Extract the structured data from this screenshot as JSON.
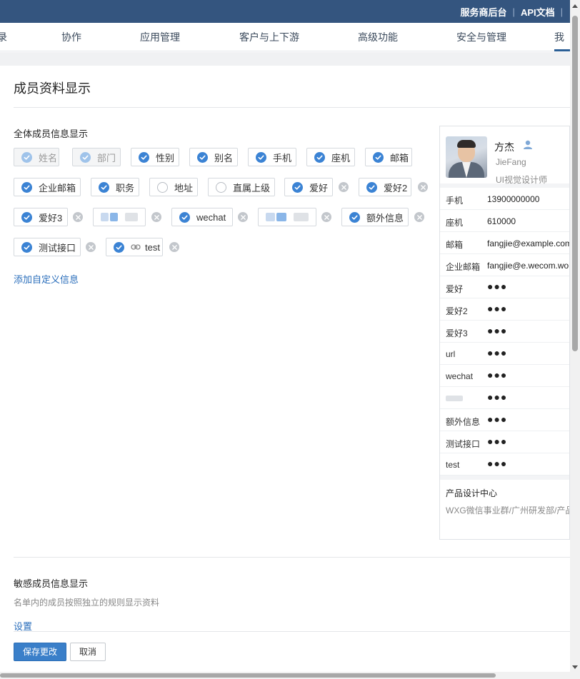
{
  "topbar": {
    "links": [
      "服务商后台",
      "API文档"
    ]
  },
  "nav": {
    "items": [
      "录",
      "协作",
      "应用管理",
      "客户与上下游",
      "高级功能",
      "安全与管理",
      "我"
    ]
  },
  "page_title": "成员资料显示",
  "all_section": {
    "label": "全体成员信息显示",
    "add_custom": "添加自定义信息"
  },
  "fields": [
    {
      "label": "姓名",
      "state": "locked"
    },
    {
      "label": "部门",
      "state": "locked"
    },
    {
      "label": "性别",
      "state": "checked"
    },
    {
      "label": "别名",
      "state": "checked"
    },
    {
      "label": "手机",
      "state": "checked"
    },
    {
      "label": "座机",
      "state": "checked"
    },
    {
      "label": "邮箱",
      "state": "checked"
    },
    {
      "label": "企业邮箱",
      "state": "checked"
    },
    {
      "label": "职务",
      "state": "checked"
    },
    {
      "label": "地址",
      "state": "unchecked"
    },
    {
      "label": "直属上级",
      "state": "unchecked"
    },
    {
      "label": "爱好",
      "state": "checked",
      "removable": true
    },
    {
      "label": "爱好2",
      "state": "checked",
      "removable": true
    },
    {
      "label": "爱好3",
      "state": "checked",
      "removable": true
    },
    {
      "label": "",
      "state": "blurred",
      "removable": true
    },
    {
      "label": "wechat",
      "state": "checked",
      "removable": true
    },
    {
      "label": "",
      "state": "blurred",
      "removable": true
    },
    {
      "label": "额外信息",
      "state": "checked",
      "removable": true
    },
    {
      "label": "测试接口",
      "state": "checked",
      "removable": true
    },
    {
      "label": "test",
      "state": "checked",
      "removable": true,
      "icon": "link-icon"
    }
  ],
  "preview": {
    "name": "方杰",
    "english_name": "JieFang",
    "title": "UI视觉设计师",
    "rows": [
      {
        "key": "手机",
        "value": "13900000000"
      },
      {
        "key": "座机",
        "value": "610000"
      },
      {
        "key": "邮箱",
        "value": "fangjie@example.com"
      },
      {
        "key": "企业邮箱",
        "value": "fangjie@e.wecom.work"
      },
      {
        "key": "爱好",
        "value": "●●●"
      },
      {
        "key": "爱好2",
        "value": "●●●"
      },
      {
        "key": "爱好3",
        "value": "●●●"
      },
      {
        "key": "url",
        "value": "●●●"
      },
      {
        "key": "wechat",
        "value": "●●●"
      },
      {
        "key": "",
        "value": "●●●"
      },
      {
        "key": "额外信息",
        "value": "●●●"
      },
      {
        "key": "测试接口",
        "value": "●●●"
      },
      {
        "key": "test",
        "value": "●●●"
      }
    ],
    "department": "产品设计中心",
    "department_path": "WXG微信事业群/广州研发部/产品设计中心"
  },
  "sensitive": {
    "title": "敏感成员信息显示",
    "desc": "名单内的成员按照独立的规则显示资料",
    "settings_link": "设置"
  },
  "actions": {
    "save": "保存更改",
    "cancel": "取消"
  },
  "colors": {
    "topbar": "#34557f",
    "accent": "#3b83d4",
    "link": "#2a6ebb"
  }
}
